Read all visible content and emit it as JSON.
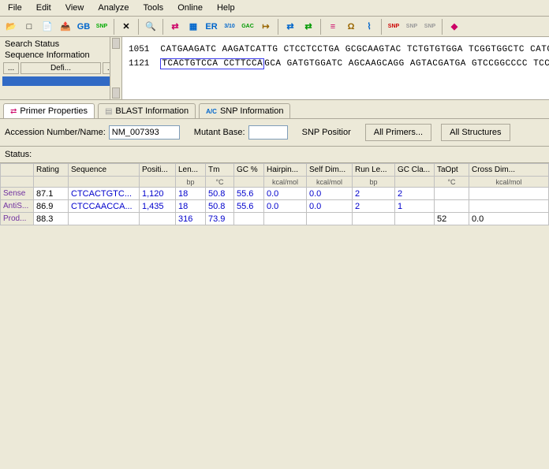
{
  "menu": [
    "File",
    "Edit",
    "View",
    "Analyze",
    "Tools",
    "Online",
    "Help"
  ],
  "toolbar_icons": [
    {
      "n": "open-icon",
      "g": "📂",
      "c": "#c90"
    },
    {
      "n": "new-icon",
      "g": "□",
      "c": "#000"
    },
    {
      "n": "save-icon",
      "g": "📄",
      "c": "#c90"
    },
    {
      "n": "export-icon",
      "g": "📤",
      "c": "#c90"
    },
    {
      "n": "gb-icon",
      "g": "GB",
      "c": "#06c"
    },
    {
      "n": "snp-tool-icon",
      "g": "SNP",
      "c": "#0a0"
    },
    {
      "n": "sep"
    },
    {
      "n": "delete-icon",
      "g": "✕",
      "c": "#000"
    },
    {
      "n": "sep"
    },
    {
      "n": "find-icon",
      "g": "🔍",
      "c": "#000"
    },
    {
      "n": "sep"
    },
    {
      "n": "swap-icon",
      "g": "⇄",
      "c": "#c06"
    },
    {
      "n": "chart-icon",
      "g": "▦",
      "c": "#06c"
    },
    {
      "n": "ertc-icon",
      "g": "ER",
      "c": "#06c"
    },
    {
      "n": "ratio-icon",
      "g": "3/10",
      "c": "#06c"
    },
    {
      "n": "codon-icon",
      "g": "GAC",
      "c": "#090"
    },
    {
      "n": "arrow-icon",
      "g": "↦",
      "c": "#960"
    },
    {
      "n": "sep"
    },
    {
      "n": "exch1-icon",
      "g": "⇄",
      "c": "#06c"
    },
    {
      "n": "exch2-icon",
      "g": "⇄",
      "c": "#090"
    },
    {
      "n": "sep"
    },
    {
      "n": "align-icon",
      "g": "≡",
      "c": "#c06"
    },
    {
      "n": "omega-icon",
      "g": "Ω",
      "c": "#960"
    },
    {
      "n": "struct-icon",
      "g": "⌇",
      "c": "#06c"
    },
    {
      "n": "sep"
    },
    {
      "n": "snp-red-icon",
      "g": "SNP",
      "c": "#c00"
    },
    {
      "n": "snp-gray1-icon",
      "g": "SNP",
      "c": "#999"
    },
    {
      "n": "snp-gray2-icon",
      "g": "SNP",
      "c": "#999"
    },
    {
      "n": "sep"
    },
    {
      "n": "help-icon",
      "g": "◆",
      "c": "#c06"
    }
  ],
  "side": {
    "status": "Search Status",
    "seqinfo": "Sequence Information",
    "defi": "Defi...",
    "dots": "..."
  },
  "seq": {
    "line1_pos": "1051",
    "line1": "CATGAAGATC AAGATCATTG CTCCTCCTGA GCGCAAGTAC TCTGTGTGGA TCGGTGGCTC CATCCTGGC",
    "line2_pos": "1121",
    "line2_boxed": "TCACTGTCCA CCTTCCA",
    "line2_rest": "GCA GATGTGGATC AGCAAGCAGG AGTACGATGA GTCCGGCCCC TCCATCGTGC"
  },
  "tabs": {
    "primer": "Primer Properties",
    "blast": "BLAST Information",
    "snp": "SNP Information"
  },
  "form": {
    "acc_label": "Accession Number/Name:",
    "acc_value": "NM_007393",
    "mutant_label": "Mutant Base:",
    "mutant_value": "",
    "snp_pos_label": "SNP Positior",
    "all_primers": "All Primers...",
    "all_structures": "All Structures"
  },
  "status_label": "Status:",
  "grid": {
    "headers": [
      {
        "t": "",
        "s": ""
      },
      {
        "t": "Rating",
        "s": ""
      },
      {
        "t": "Sequence",
        "s": ""
      },
      {
        "t": "Positi...",
        "s": ""
      },
      {
        "t": "Len...",
        "s": "bp"
      },
      {
        "t": "Tm",
        "s": "°C"
      },
      {
        "t": "GC %",
        "s": ""
      },
      {
        "t": "Hairpin...",
        "s": "kcal/mol"
      },
      {
        "t": "Self Dim...",
        "s": "kcal/mol"
      },
      {
        "t": "Run Le...",
        "s": "bp"
      },
      {
        "t": "GC Cla...",
        "s": ""
      },
      {
        "t": "TaOpt",
        "s": "°C"
      },
      {
        "t": "Cross Dim...",
        "s": "kcal/mol"
      }
    ],
    "rows": [
      {
        "n": "Sense",
        "rating": "87.1",
        "seq": "CTCACTGTC...",
        "pos": "1,120",
        "len": "18",
        "tm": "50.8",
        "gc": "55.6",
        "hp": "0.0",
        "sd": "0.0",
        "run": "2",
        "gcc": "2",
        "ta": "",
        "cd": ""
      },
      {
        "n": "AntiS...",
        "rating": "86.9",
        "seq": "CTCCAACCA...",
        "pos": "1,435",
        "len": "18",
        "tm": "50.8",
        "gc": "55.6",
        "hp": "0.0",
        "sd": "0.0",
        "run": "2",
        "gcc": "1",
        "ta": "",
        "cd": ""
      },
      {
        "n": "Prod...",
        "rating": "88.3",
        "seq": "",
        "pos": "",
        "len": "316",
        "tm": "73.9",
        "gc": "",
        "hp": "",
        "sd": "",
        "run": "",
        "gcc": "",
        "ta": "52",
        "cd": "0.0"
      }
    ]
  }
}
